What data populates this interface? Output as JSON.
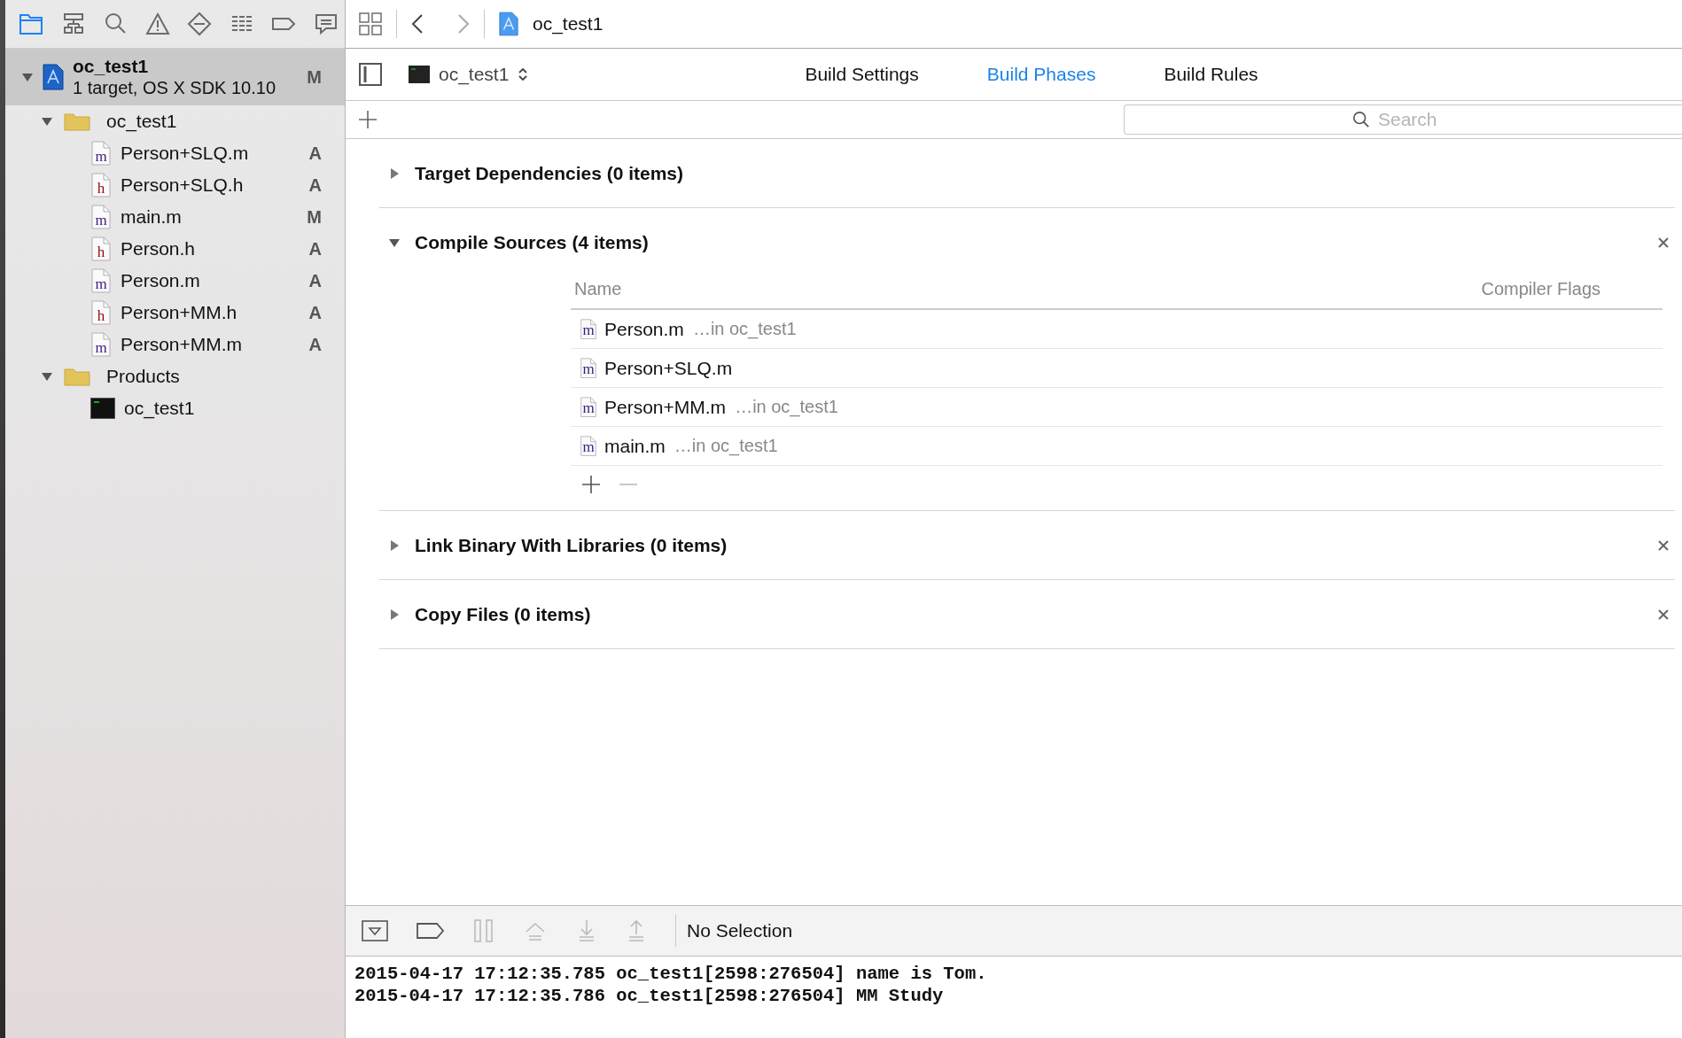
{
  "navigator_tabs": [
    {
      "selected": true
    },
    {
      "selected": false
    },
    {
      "selected": false
    },
    {
      "selected": false
    },
    {
      "selected": false
    },
    {
      "selected": false
    },
    {
      "selected": false
    },
    {
      "selected": false
    }
  ],
  "project": {
    "name": "oc_test1",
    "subtitle": "1 target, OS X SDK 10.10",
    "status": "M",
    "expanded": true,
    "selected": true
  },
  "tree": [
    {
      "name": "oc_test1",
      "expanded": true,
      "children": [
        {
          "name": "Person+SLQ.m",
          "kind": "implementation",
          "letter": "m",
          "status": "A"
        },
        {
          "name": "Person+SLQ.h",
          "kind": "header",
          "letter": "h",
          "status": "A"
        },
        {
          "name": "main.m",
          "kind": "implementation",
          "letter": "m",
          "status": "M"
        },
        {
          "name": "Person.h",
          "kind": "header",
          "letter": "h",
          "status": "A"
        },
        {
          "name": "Person.m",
          "kind": "implementation",
          "letter": "m",
          "status": "A"
        },
        {
          "name": "Person+MM.h",
          "kind": "header",
          "letter": "h",
          "status": "A"
        },
        {
          "name": "Person+MM.m",
          "kind": "implementation",
          "letter": "m",
          "status": "A"
        }
      ]
    },
    {
      "name": "Products",
      "expanded": true,
      "children": [
        {
          "name": "oc_test1",
          "kind": "product"
        }
      ]
    }
  ],
  "jump_bar": {
    "path": "oc_test1"
  },
  "target_popup": {
    "label": "oc_test1"
  },
  "tabs": [
    {
      "label": "Build Settings",
      "selected": false
    },
    {
      "label": "Build Phases",
      "selected": true
    },
    {
      "label": "Build Rules",
      "selected": false
    }
  ],
  "search": {
    "placeholder": "Search"
  },
  "phases": [
    {
      "title": "Target Dependencies (0 items)",
      "expanded": false,
      "removable": false
    },
    {
      "title": "Compile Sources (4 items)",
      "expanded": true,
      "removable": true,
      "table": {
        "columns": [
          "Name",
          "Compiler Flags"
        ],
        "rows": [
          {
            "name": "Person.m",
            "letter": "m",
            "location": "…in oc_test1"
          },
          {
            "name": "Person+SLQ.m",
            "letter": "m"
          },
          {
            "name": "Person+MM.m",
            "letter": "m",
            "location": "…in oc_test1"
          },
          {
            "name": "main.m",
            "letter": "m",
            "location": "…in oc_test1"
          }
        ]
      }
    },
    {
      "title": "Link Binary With Libraries (0 items)",
      "expanded": false,
      "removable": true
    },
    {
      "title": "Copy Files (0 items)",
      "expanded": false,
      "removable": true
    }
  ],
  "debug_bar": {
    "status": "No Selection"
  },
  "console": {
    "lines": [
      "2015-04-17 17:12:35.785 oc_test1[2598:276504] name is Tom.",
      "2015-04-17 17:12:35.786 oc_test1[2598:276504] MM Study"
    ]
  }
}
